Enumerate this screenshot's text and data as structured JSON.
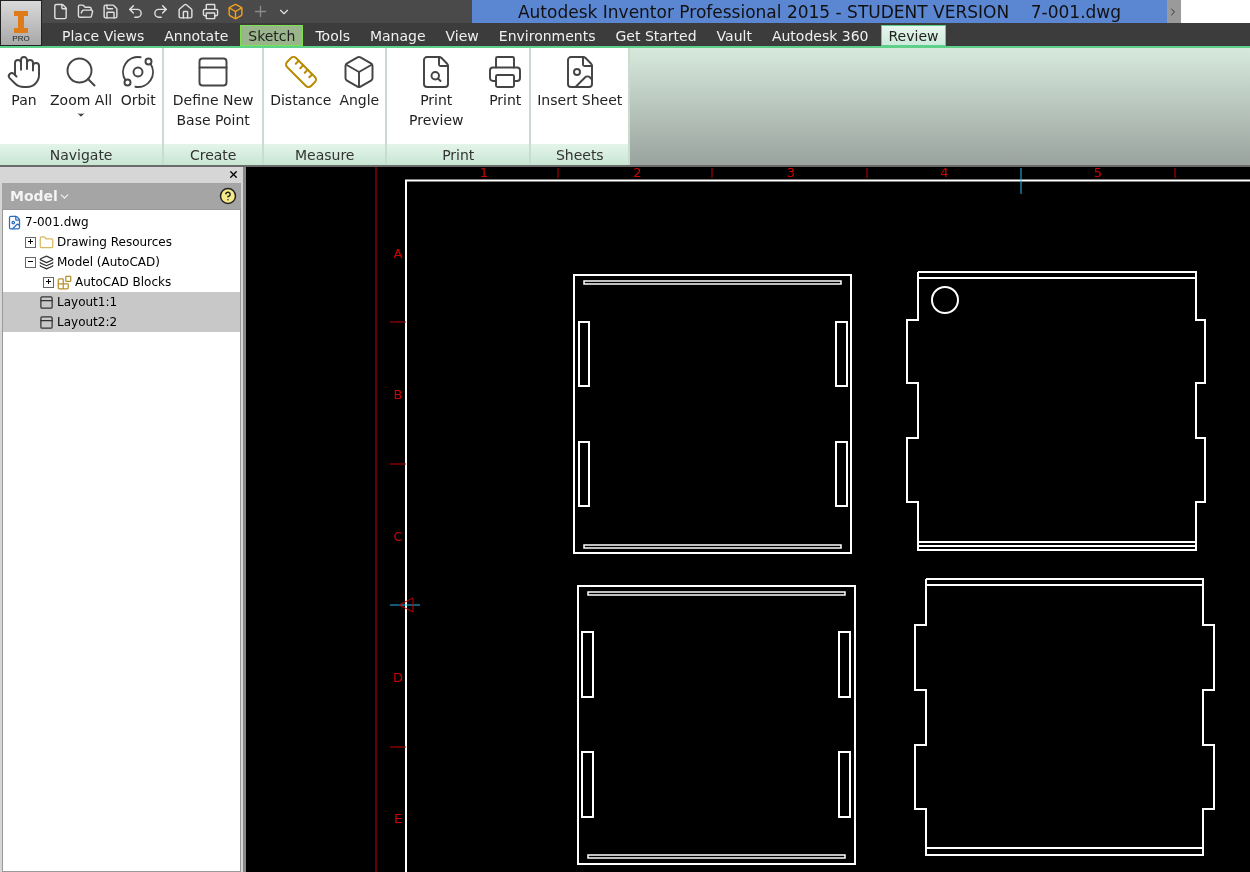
{
  "app_menu": {
    "badge": "PRO"
  },
  "window": {
    "title": "Autodesk Inventor Professional 2015 - STUDENT VERSION    7-001.dwg"
  },
  "tabs": [
    {
      "label": "Place Views",
      "selected": false,
      "highlighted": false
    },
    {
      "label": "Annotate",
      "selected": false,
      "highlighted": false
    },
    {
      "label": "Sketch",
      "selected": false,
      "highlighted": true
    },
    {
      "label": "Tools",
      "selected": false,
      "highlighted": false
    },
    {
      "label": "Manage",
      "selected": false,
      "highlighted": false
    },
    {
      "label": "View",
      "selected": false,
      "highlighted": false
    },
    {
      "label": "Environments",
      "selected": false,
      "highlighted": false
    },
    {
      "label": "Get Started",
      "selected": false,
      "highlighted": false
    },
    {
      "label": "Vault",
      "selected": false,
      "highlighted": false
    },
    {
      "label": "Autodesk 360",
      "selected": false,
      "highlighted": false
    },
    {
      "label": "Review",
      "selected": true,
      "highlighted": false
    }
  ],
  "ribbon_panels": [
    {
      "title": "Navigate",
      "tools": [
        {
          "label": "Pan",
          "kind": "pan",
          "dropdown": false
        },
        {
          "label": "Zoom All",
          "kind": "zoom",
          "dropdown": true
        },
        {
          "label": "Orbit",
          "kind": "orbit",
          "dropdown": false
        }
      ]
    },
    {
      "title": "Create",
      "tools": [
        {
          "label": "Define New Base Point",
          "kind": "basepoint",
          "dropdown": false
        }
      ]
    },
    {
      "title": "Measure",
      "tools": [
        {
          "label": "Distance",
          "kind": "distance",
          "dropdown": false
        },
        {
          "label": "Angle",
          "kind": "angle",
          "dropdown": false
        }
      ]
    },
    {
      "title": "Print",
      "tools": [
        {
          "label": "Print Preview",
          "kind": "preview",
          "dropdown": false
        },
        {
          "label": "Print",
          "kind": "print",
          "dropdown": false
        }
      ]
    },
    {
      "title": "Sheets",
      "tools": [
        {
          "label": "Insert Sheet",
          "kind": "sheet",
          "dropdown": false
        }
      ]
    }
  ],
  "browser": {
    "title": "Model",
    "tree": [
      {
        "label": "7-001.dwg",
        "kind": "dwg",
        "selected": false,
        "children": [
          {
            "label": "Drawing Resources",
            "kind": "folder",
            "selected": false,
            "expanded": false
          },
          {
            "label": "Model (AutoCAD)",
            "kind": "model",
            "selected": false,
            "expanded": true,
            "children": [
              {
                "label": "AutoCAD Blocks",
                "kind": "blocks",
                "selected": false,
                "expanded": false
              }
            ]
          },
          {
            "label": "Layout1:1",
            "kind": "layout",
            "selected": true
          },
          {
            "label": "Layout2:2",
            "kind": "layout",
            "selected": true
          }
        ]
      }
    ]
  },
  "canvas": {
    "column_labels": [
      "1",
      "2",
      "3",
      "4",
      "5"
    ],
    "row_labels": [
      "A",
      "B",
      "C",
      "D",
      "E"
    ]
  }
}
